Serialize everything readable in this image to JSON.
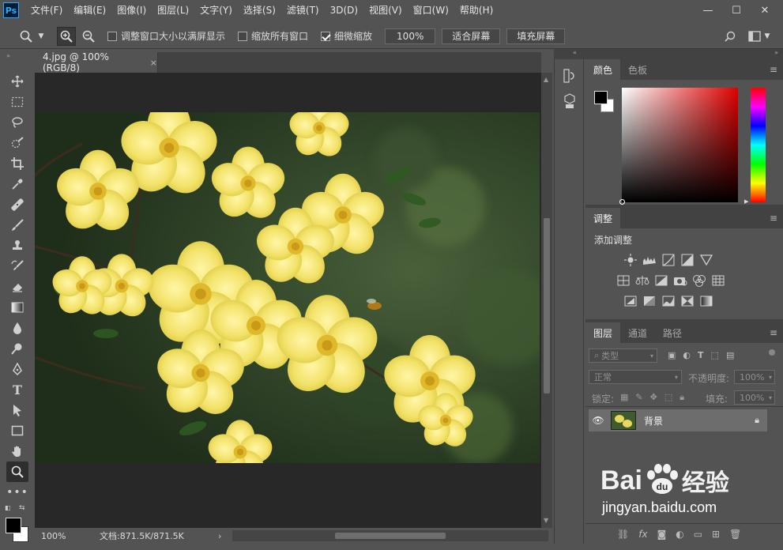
{
  "app": {
    "logo": "Ps"
  },
  "menu": [
    "文件(F)",
    "编辑(E)",
    "图像(I)",
    "图层(L)",
    "文字(Y)",
    "选择(S)",
    "滤镜(T)",
    "3D(D)",
    "视图(V)",
    "窗口(W)",
    "帮助(H)"
  ],
  "options": {
    "resize_windows": "调整窗口大小以满屏显示",
    "zoom_all": "缩放所有窗口",
    "scrubby_zoom": "细微缩放",
    "zoom_value": "100%",
    "fit_screen": "适合屏幕",
    "fill_screen": "填充屏幕"
  },
  "document": {
    "tab_title": "4.jpg @ 100%(RGB/8)",
    "close": "×"
  },
  "status": {
    "zoom": "100%",
    "doc_size": "文档:871.5K/871.5K",
    "arrow": "›"
  },
  "color_panel": {
    "tabs": [
      "颜色",
      "色板"
    ],
    "fg": "#000000",
    "bg": "#ffffff"
  },
  "adjust_panel": {
    "tab": "调整",
    "title": "添加调整"
  },
  "layers_panel": {
    "tabs": [
      "图层",
      "通道",
      "路径"
    ],
    "filter_kind": "类型",
    "blend_mode": "正常",
    "opacity_label": "不透明度:",
    "opacity_value": "100%",
    "lock_label": "锁定:",
    "fill_label": "填充:",
    "fill_value": "100%",
    "layers": [
      {
        "name": "背景"
      }
    ]
  },
  "watermark": {
    "brand": "Bai",
    "brand2": "经验",
    "url": "jingyan.baidu.com"
  }
}
